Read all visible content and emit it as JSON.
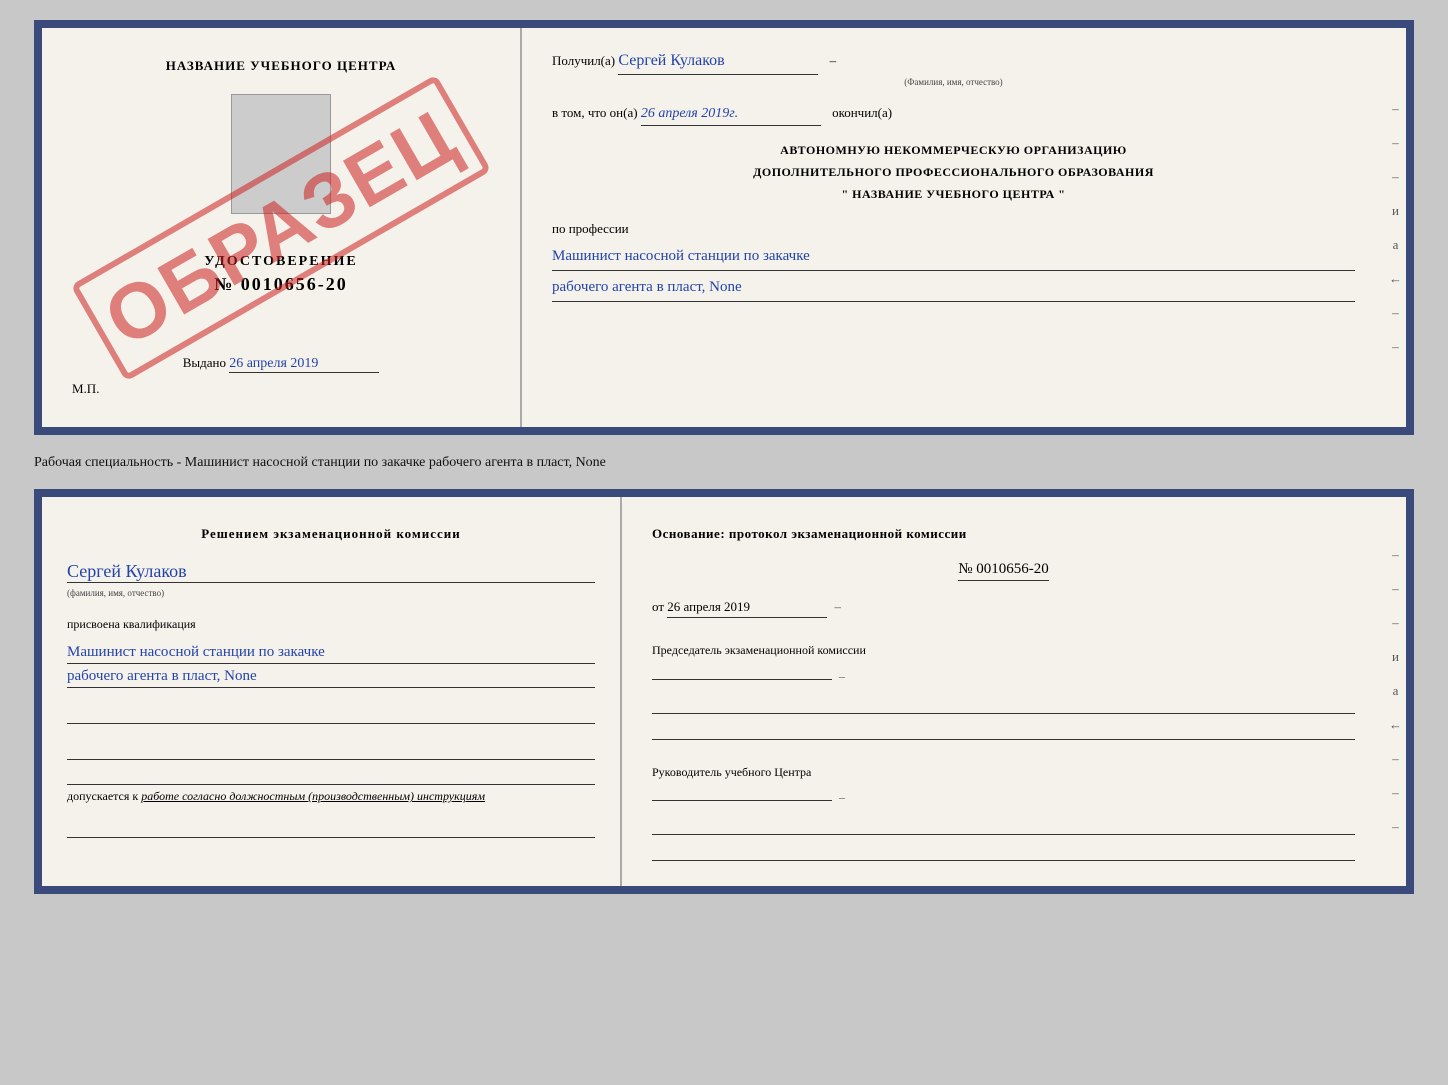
{
  "top_cert": {
    "left": {
      "title": "НАЗВАНИЕ УЧЕБНОГО ЦЕНТРА",
      "stamp": "ОБРАЗЕЦ",
      "udostoverenie_label": "УДОСТОВЕРЕНИЕ",
      "number": "№ 0010656-20",
      "vydano_label": "Выдано",
      "vydano_date": "26 апреля 2019",
      "mp": "М.П."
    },
    "right": {
      "poluchil_label": "Получил(a)",
      "poluchil_name": "Сергей Кулаков",
      "familiya_label": "(Фамилия, имя, отчество)",
      "v_tom_label": "в том, что он(a)",
      "v_tom_date": "26 апреля 2019г.",
      "okonchil_label": "окончил(а)",
      "org_line1": "АВТОНОМНУЮ НЕКОММЕРЧЕСКУЮ ОРГАНИЗАЦИЮ",
      "org_line2": "ДОПОЛНИТЕЛЬНОГО ПРОФЕССИОНАЛЬНОГО ОБРАЗОВАНИЯ",
      "org_line3": "\"   НАЗВАНИЕ УЧЕБНОГО ЦЕНТРА   \"",
      "po_professii": "по профессии",
      "profession_line1": "Машинист насосной станции по закачке",
      "profession_line2": "рабочего агента в пласт, None"
    }
  },
  "subtitle": "Рабочая специальность - Машинист насосной станции по закачке рабочего агента в пласт, None",
  "bottom_cert": {
    "left": {
      "komissia_text": "Решением экзаменационной комиссии",
      "name": "Сергей Кулаков",
      "familiya_label": "(фамилия, имя, отчество)",
      "prisvoena": "присвоена квалификация",
      "kvali_line1": "Машинист насосной станции по закачке",
      "kvali_line2": "рабочего агента в пласт, None",
      "dopuskaetsya_prefix": "допускается к",
      "dopuskaetsya_text": "работе согласно должностным (производственным) инструкциям"
    },
    "right": {
      "osnovanie_label": "Основание: протокол экзаменационной комиссии",
      "number_label": "№ 0010656-20",
      "ot_label": "от",
      "ot_date": "26 апреля 2019",
      "predsedatel_label": "Председатель экзаменационной комиссии",
      "rukovoditel_label": "Руководитель учебного Центра"
    }
  },
  "dashes": [
    "-",
    "-",
    "-",
    "-",
    "и",
    "а",
    "←",
    "-",
    "-",
    "-",
    "-",
    "-",
    "-"
  ]
}
